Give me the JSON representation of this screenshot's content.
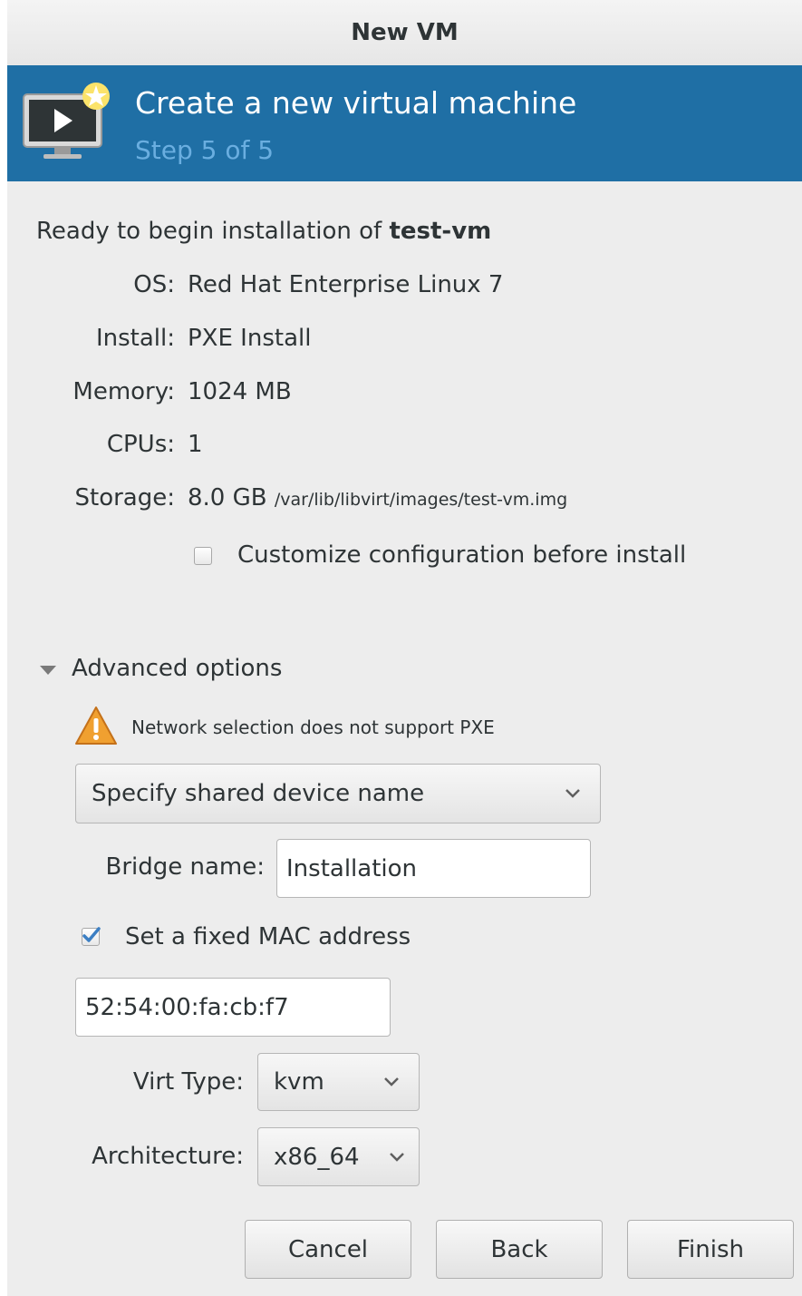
{
  "window": {
    "title": "New VM"
  },
  "header": {
    "title": "Create a new virtual machine",
    "step": "Step 5 of 5",
    "icon": "vm-monitor-star-icon"
  },
  "summary": {
    "ready_prefix": "Ready to begin installation of ",
    "vm_name": "test-vm",
    "rows": [
      {
        "label": "OS:",
        "value": "Red Hat Enterprise Linux 7"
      },
      {
        "label": "Install:",
        "value": "PXE Install"
      },
      {
        "label": "Memory:",
        "value": "1024 MB"
      },
      {
        "label": "CPUs:",
        "value": "1"
      },
      {
        "label": "Storage:",
        "value": "8.0 GB",
        "detail": "/var/lib/libvirt/images/test-vm.img"
      }
    ],
    "customize_label": "Customize configuration before install",
    "customize_checked": false
  },
  "advanced": {
    "label": "Advanced options",
    "expanded": true,
    "warning": "Network selection does not support PXE",
    "network_select": "Specify shared device name",
    "bridge_label": "Bridge name:",
    "bridge_value": "Installation",
    "mac_label": "Set a fixed MAC address",
    "mac_checked": true,
    "mac_value": "52:54:00:fa:cb:f7",
    "virt_type_label": "Virt Type:",
    "virt_type_value": "kvm",
    "arch_label": "Architecture:",
    "arch_value": "x86_64"
  },
  "buttons": {
    "cancel": "Cancel",
    "back": "Back",
    "finish": "Finish"
  },
  "colors": {
    "header_bg": "#1f6fa5",
    "header_step": "#6aaee0",
    "warning": "#f0a030"
  }
}
